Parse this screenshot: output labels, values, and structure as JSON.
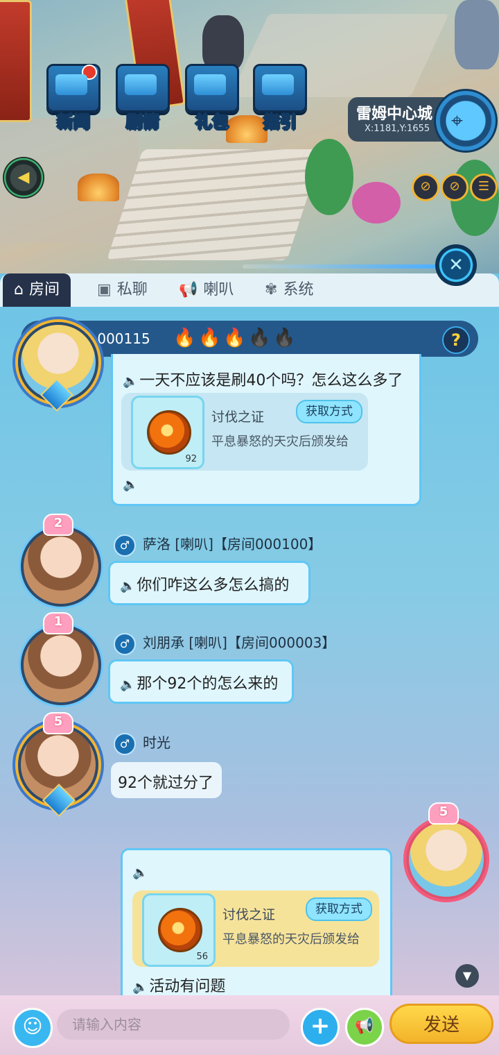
{
  "top_menu": {
    "news": "新闻",
    "story": "剧情",
    "gift": "礼包",
    "guide": "指引"
  },
  "location": {
    "name": "雷姆中心城",
    "coords": "X:1181,Y:1655"
  },
  "tabs": [
    {
      "label": "房间",
      "icon": "house-icon",
      "active": true
    },
    {
      "label": "私聊",
      "icon": "monitor-icon",
      "active": false
    },
    {
      "label": "喇叭",
      "icon": "horn-icon",
      "active": false
    },
    {
      "label": "系统",
      "icon": "flower-icon",
      "active": false
    }
  ],
  "room": {
    "label": "当前房间 000115",
    "flames_active": 3,
    "flames_total": 5,
    "help": "?"
  },
  "messages": [
    {
      "text": "一天不应该是刷40个吗？怎么这么多了",
      "item": {
        "name": "讨伐之证",
        "desc": "平息暴怒的天灾后颁发给",
        "count": "92",
        "button": "获取方式"
      }
    },
    {
      "level": "2",
      "sender": "萨洛 [喇叭]【房间000100】",
      "text": "你们咋这么多怎么搞的"
    },
    {
      "level": "1",
      "sender": "刘朋承 [喇叭]【房间000003】",
      "text": "那个92个的怎么来的"
    },
    {
      "level": "5",
      "sender": "时光",
      "text": "92个就过分了"
    },
    {
      "self": true,
      "level": "5",
      "item": {
        "name": "讨伐之证",
        "desc": "平息暴怒的天灾后颁发给",
        "count": "56",
        "button": "获取方式"
      },
      "text": "活动有问题"
    }
  ],
  "input": {
    "placeholder": "请输入内容",
    "send": "发送"
  },
  "colors": {
    "room_bar": "#24588a",
    "active_tab": "#25324a",
    "bubble_border": "#5fc7f5",
    "send_button": "#f3b32a"
  }
}
